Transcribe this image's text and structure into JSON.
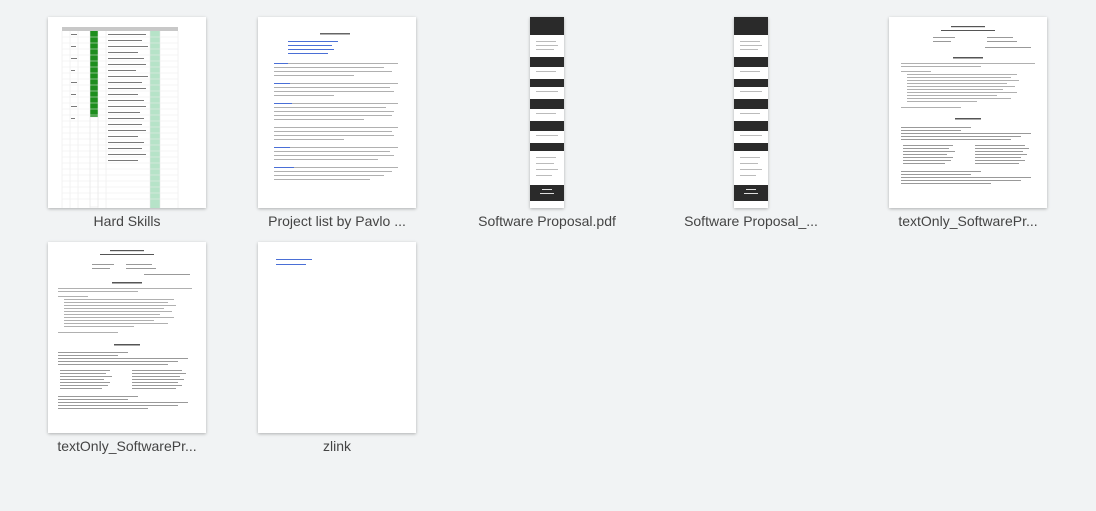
{
  "files": [
    {
      "name": "Hard Skills",
      "kind": "spreadsheet"
    },
    {
      "name": "Project list by Pavlo ...",
      "kind": "doc"
    },
    {
      "name": "Software Proposal.pdf",
      "kind": "pdf"
    },
    {
      "name": "Software Proposal_...",
      "kind": "pdf"
    },
    {
      "name": "textOnly_SoftwarePr...",
      "kind": "doc"
    },
    {
      "name": "textOnly_SoftwarePr...",
      "kind": "doc"
    },
    {
      "name": "zlink",
      "kind": "doc"
    }
  ],
  "colors": {
    "background": "#f1f3f4",
    "label": "#444444",
    "sheet_green": "#1e8e1e",
    "sheet_mint": "#b6e3c8",
    "link": "#4a6fd6"
  },
  "icons": {
    "document": "document-thumbnail-icon",
    "spreadsheet": "spreadsheet-thumbnail-icon",
    "pdf": "pdf-thumbnail-icon"
  }
}
